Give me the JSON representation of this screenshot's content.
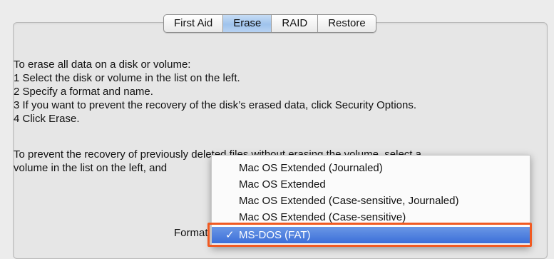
{
  "tabs": [
    {
      "label": "First Aid",
      "selected": false
    },
    {
      "label": "Erase",
      "selected": true
    },
    {
      "label": "RAID",
      "selected": false
    },
    {
      "label": "Restore",
      "selected": false
    }
  ],
  "instructions": {
    "heading": "To erase all data on a disk or volume:",
    "steps": [
      "1 Select the disk or volume in the list on the left.",
      "2 Specify a format and name.",
      "3 If you want to prevent the recovery of the disk’s erased data, click Security Options.",
      "4 Click Erase."
    ],
    "prevent_line1": "To prevent the recovery of previously deleted files without erasing the volume, select a",
    "prevent_line2": "volume in the list on the left, and"
  },
  "format": {
    "label": "Format",
    "selected_check": "✓",
    "options": [
      "Mac OS Extended (Journaled)",
      "Mac OS Extended",
      "Mac OS Extended (Case-sensitive, Journaled)",
      "Mac OS Extended (Case-sensitive)",
      "MS-DOS (FAT)"
    ]
  },
  "colors": {
    "highlight_border": "#f15a22",
    "menu_selection": "#3c6fd8",
    "tab_selected": "#9fc3ec"
  }
}
